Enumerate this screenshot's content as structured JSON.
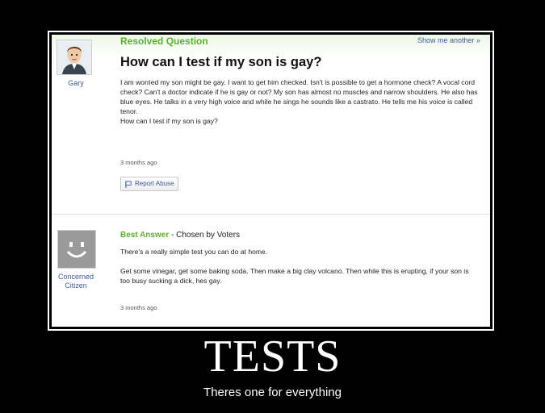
{
  "question": {
    "status_title": "Resolved Question",
    "show_another": "Show me another »",
    "asker_name": "Gary",
    "title": "How can I test if my son is gay?",
    "body": "I am worried my son might be gay. I want to get him checked. Isn't is possible to get a hormone check? A vocal cord check? Can't a doctor indicate if he is gay or not? My son has almost no muscles and narrow shoulders. He also has blue eyes. He talks in a very high voice and while he sings he sounds like a castrato. He tells me his voice is called tenor.",
    "body_last_line": "How can I test if my son is gay?",
    "timestamp": "3 months ago",
    "report_label": "Report Abuse",
    "report_icon": "flag-icon",
    "avatar_icon": "user-avatar"
  },
  "answer": {
    "label": "Best Answer",
    "chosen_by": " - Chosen by Voters",
    "author_name_line1": "Concerned",
    "author_name_line2": "Citizen",
    "para1": "There's a really simple test you can do at home.",
    "para2": "Get some vinegar, get some baking soda. Then make a big clay volcano. Then while this is erupting, if your son is too busy sucking a dick, hes gay.",
    "timestamp": "3 months ago",
    "avatar_icon": "smiley-avatar"
  },
  "caption": {
    "title": "TESTS",
    "subtitle": "Theres one for everything"
  },
  "colors": {
    "brand_green": "#5cb12d",
    "link_blue": "#3b5b9b",
    "background": "#000000"
  }
}
